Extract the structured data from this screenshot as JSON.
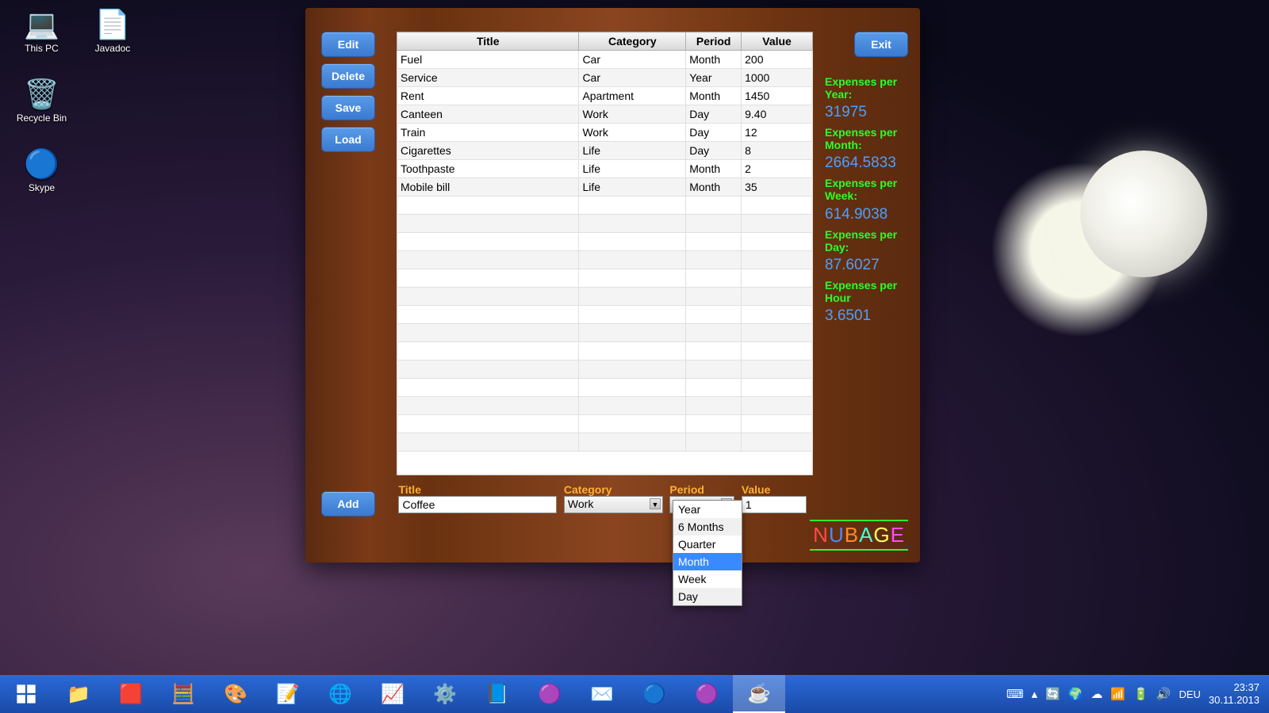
{
  "desktop": {
    "icons": [
      {
        "label": "This PC",
        "glyph": "💻"
      },
      {
        "label": "Javadoc",
        "glyph": "📄"
      },
      {
        "label": "Recycle Bin",
        "glyph": "🗑️"
      },
      {
        "label": "Skype",
        "glyph": "🔵"
      }
    ]
  },
  "app": {
    "buttons": {
      "edit": "Edit",
      "delete": "Delete",
      "save": "Save",
      "load": "Load",
      "add": "Add",
      "exit": "Exit"
    },
    "table": {
      "headers": {
        "title": "Title",
        "category": "Category",
        "period": "Period",
        "value": "Value"
      },
      "rows": [
        {
          "title": "Fuel",
          "category": "Car",
          "period": "Month",
          "value": "200"
        },
        {
          "title": "Service",
          "category": "Car",
          "period": "Year",
          "value": "1000"
        },
        {
          "title": "Rent",
          "category": "Apartment",
          "period": "Month",
          "value": "1450"
        },
        {
          "title": "Canteen",
          "category": "Work",
          "period": "Day",
          "value": "9.40"
        },
        {
          "title": "Train",
          "category": "Work",
          "period": "Day",
          "value": "12"
        },
        {
          "title": "Cigarettes",
          "category": "Life",
          "period": "Day",
          "value": "8"
        },
        {
          "title": "Toothpaste",
          "category": "Life",
          "period": "Month",
          "value": "2"
        },
        {
          "title": "Mobile bill",
          "category": "Life",
          "period": "Month",
          "value": "35"
        }
      ],
      "blank_rows": 14
    },
    "summary": {
      "year_lbl": "Expenses per Year:",
      "year_val": "31975",
      "month_lbl": "Expenses per Month:",
      "month_val": "2664.5833",
      "week_lbl": "Expenses per Week:",
      "week_val": "614.9038",
      "day_lbl": "Expenses per Day:",
      "day_val": "87.6027",
      "hour_lbl": "Expenses per Hour",
      "hour_val": "3.6501"
    },
    "form": {
      "title_lbl": "Title",
      "title_val": "Coffee",
      "category_lbl": "Category",
      "category_val": "Work",
      "period_lbl": "Period",
      "period_val": "Month",
      "value_lbl": "Value",
      "value_val": "1",
      "period_options": [
        "Year",
        "6 Months",
        "Quarter",
        "Month",
        "Week",
        "Day"
      ],
      "period_selected": "Month"
    },
    "logo": "NUBAGE"
  },
  "taskbar": {
    "lang": "DEU",
    "time": "23:37",
    "date": "30.11.2013"
  }
}
